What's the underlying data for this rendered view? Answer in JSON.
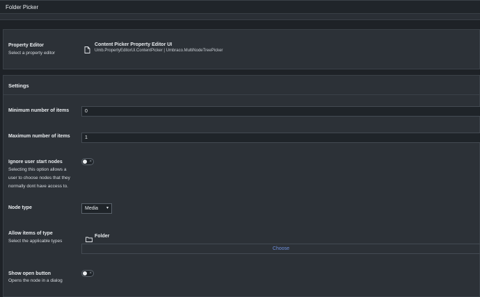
{
  "header": {
    "name_value": "Folder Picker"
  },
  "property_editor": {
    "label": "Property Editor",
    "description": "Select a property editor",
    "editor_name": "Content Picker Property Editor UI",
    "editor_alias": "Umb.PropertyEditorUi.ContentPicker | Umbraco.MultiNodeTreePicker",
    "icon": "document-icon"
  },
  "settings": {
    "title": "Settings",
    "min_items": {
      "label": "Minimum number of items",
      "value": "0"
    },
    "max_items": {
      "label": "Maximum number of items",
      "value": "1"
    },
    "ignore_start_nodes": {
      "label": "Ignore user start nodes",
      "description_lines": [
        "Selecting this option allows a",
        "user to choose nodes that they",
        "normally dont have access to."
      ],
      "checked": false
    },
    "node_type": {
      "label": "Node type",
      "selected": "Media",
      "icon": "chevron-down-icon"
    },
    "allow_items": {
      "label": "Allow items of type",
      "description": "Select the applicable types",
      "item": "Folder",
      "choose_label": "Choose",
      "icon": "folder-icon"
    },
    "show_open_button": {
      "label": "Show open button",
      "description": "Opens the node in a dialog",
      "checked": false
    }
  },
  "colors": {
    "accent": "#6e8fdd"
  }
}
